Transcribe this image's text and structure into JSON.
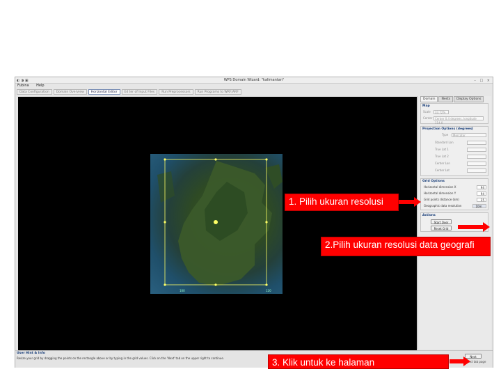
{
  "window": {
    "title": "WPS Domain Wizard: \"kalimantan\"",
    "menu": [
      "Fubina",
      "Help"
    ]
  },
  "steps": [
    "Data Configuration",
    "Domain Overview",
    "Horizontal Editor",
    "Ed ter of Input Files",
    "Run Preprocessors",
    "Run Programs to WRF/ARF"
  ],
  "panel": {
    "tabs": [
      "Domain",
      "Nests",
      "Display Options"
    ],
    "map": {
      "title": "Map",
      "scale_label": "Scale",
      "scale_value": "33.72%",
      "center_label": "Center",
      "center_value": "Center 0.4 degrees, longitude 114.0"
    },
    "projection": {
      "title": "Projection Options (degrees)",
      "type_label": "Type",
      "type_value": "Mercator",
      "fields": [
        "Standard Lon",
        "True Lat 1",
        "True Lat 2",
        "Center Lon",
        "Center Lat"
      ]
    },
    "grid": {
      "title": "Grid Options",
      "rows": [
        {
          "label": "Horizontal dimension X",
          "value": "94"
        },
        {
          "label": "Horizontal dimension Y",
          "value": "94"
        },
        {
          "label": "Grid points distance (km)",
          "value": "25"
        },
        {
          "label": "Geographic data resolution",
          "value": "10m"
        }
      ]
    },
    "actions": {
      "title": "Actions",
      "start_over": "Start Over",
      "reset_grid": "Reset Grid"
    }
  },
  "info": {
    "title": "User Hint & Info",
    "text": "Resize your grid by dragging the points on the rectangle above or by typing in the grid values. Click on the 'Next' tab on the upper right to continue."
  },
  "buttons": {
    "next": "Next"
  },
  "footer": {
    "hint": "Next tab page"
  },
  "map_labels": {
    "lon_left": "100",
    "lon_right": "120"
  },
  "annotations": {
    "one": "1. Pilih ukuran resolusi",
    "two": "2.Pilih ukuran resolusi data geografi",
    "three": "3. Klik untuk ke halaman"
  },
  "colors": {
    "annotation": "#ff0000",
    "canvas": "#000000",
    "selection": "#ffff66"
  }
}
